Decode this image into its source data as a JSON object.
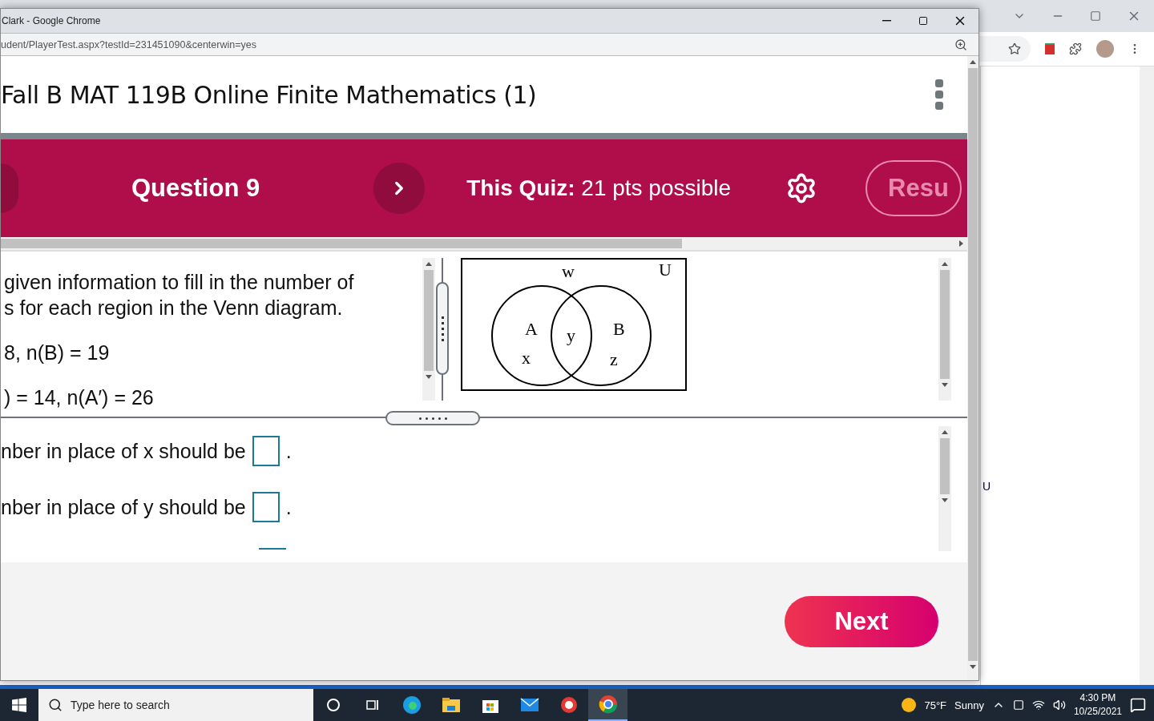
{
  "background_window": {
    "side_text": "U"
  },
  "popup_window": {
    "title": "Clark - Google Chrome",
    "url": "udent/PlayerTest.aspx?testId=231451090&centerwin=yes"
  },
  "course_title": "Fall B MAT 119B Online Finite Mathematics (1)",
  "quiz_bar": {
    "question": "Question 9",
    "quiz_label": "This Quiz:",
    "points": "21 pts possible",
    "results_button": "Resu"
  },
  "question": {
    "lines": [
      "given information to fill in the number of",
      "s for each region in the Venn diagram.",
      "8, n(B) = 19",
      ") = 14, n(A′) = 26"
    ],
    "venn": {
      "universe_label": "U",
      "outside_label": "w",
      "set_a": "A",
      "set_b": "B",
      "only_a": "x",
      "both": "y",
      "only_b": "z"
    }
  },
  "answers": [
    {
      "text": "nber in place of x should be",
      "suffix": "."
    },
    {
      "text": "nber in place of y should be",
      "suffix": "."
    }
  ],
  "next_button": "Next",
  "taskbar": {
    "search_placeholder": "Type here to search",
    "temperature": "75°F",
    "condition": "Sunny",
    "time": "4:30 PM",
    "date": "10/25/2021"
  }
}
